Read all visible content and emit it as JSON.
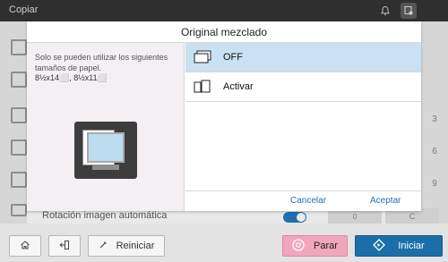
{
  "app": {
    "title": "Copiar"
  },
  "dialog": {
    "title": "Original  mezclado",
    "message": "Solo se pueden utilizar los siguientes tamaños de papel.",
    "sizes": "8½x14⬜, 8½x11⬜",
    "options": [
      {
        "label": "OFF",
        "selected": true
      },
      {
        "label": "Activar",
        "selected": false
      }
    ],
    "cancel_label": "Cancelar",
    "accept_label": "Aceptar"
  },
  "background": {
    "auto_rotation_label": "Rotación  imagen  automática",
    "right_numbers": [
      "3",
      "6",
      "9",
      "C"
    ],
    "bottom_cells": [
      "0",
      "C"
    ]
  },
  "bottombar": {
    "reset_label": "Reiniciar",
    "stop_label": "Parar",
    "start_label": "Iniciar"
  },
  "colors": {
    "selected_option": "#c8e1f3",
    "link_blue": "#1b72b8",
    "stop_pink": "#f0a6bd",
    "start_blue": "#1b6fa8"
  }
}
